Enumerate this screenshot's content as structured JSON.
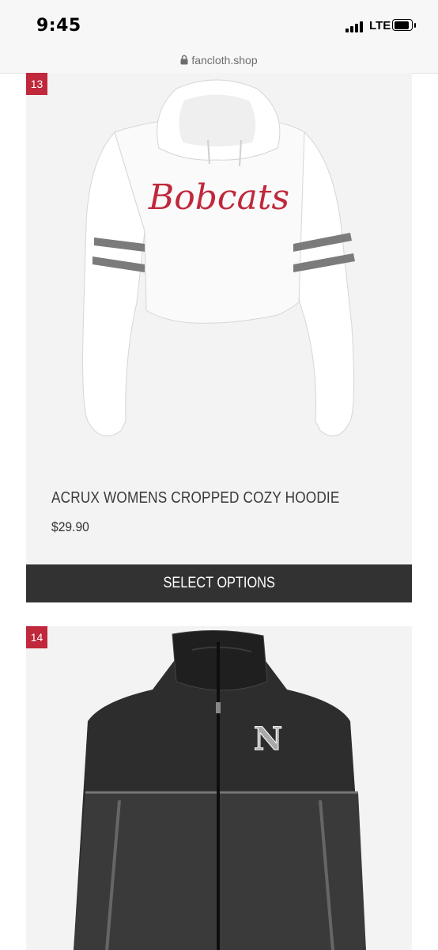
{
  "status_bar": {
    "time": "9:45",
    "network": "LTE"
  },
  "browser": {
    "url": "fancloth.shop"
  },
  "products": [
    {
      "index": "13",
      "title": "ACRUX WOMENS CROPPED COZY HOODIE",
      "price": "$29.90",
      "image_text": "Bobcats",
      "button_label": "SELECT OPTIONS"
    },
    {
      "index": "14",
      "image_text": "N"
    }
  ],
  "colors": {
    "badge": "#c0283b",
    "button": "#323232",
    "card": "#f3f3f3",
    "accent_text": "#c0283b"
  },
  "icons": [
    "lock-icon",
    "signal-icon",
    "battery-icon"
  ]
}
